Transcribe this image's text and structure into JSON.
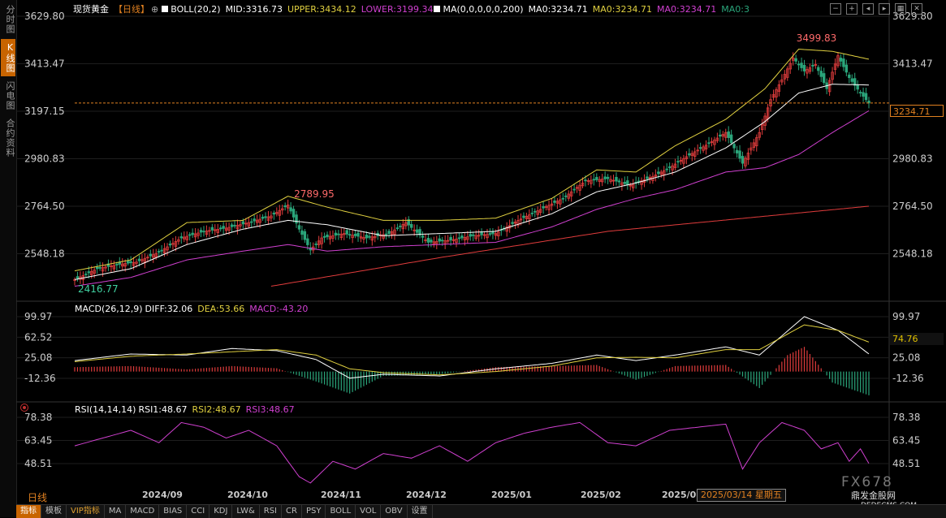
{
  "left_tabs": [
    "分时图",
    "K线图",
    "闪电图",
    "合约资料"
  ],
  "active_tab": 1,
  "header": {
    "symbol": "现货黄金",
    "period": "【日线】",
    "plus": "⊕",
    "boll": "BOLL(20,2)",
    "mid": "MID:3316.73",
    "upper": "UPPER:3434.12",
    "lower": "LOWER:3199.34",
    "ma": "MA(0,0,0,0,0,200)",
    "ma_a": "MA0:3234.71",
    "ma_b": "MA0:3234.71",
    "ma_c": "MA0:3234.71",
    "ma_d": "MA0:3"
  },
  "macd_header": {
    "name": "MACD(26,12,9)",
    "diff": "DIFF:32.06",
    "dea": "DEA:53.66",
    "macd": "MACD:-43.20"
  },
  "rsi_header": {
    "name": "RSI(14,14,14)",
    "rsi1": "RSI1:48.67",
    "rsi2": "RSI2:48.67",
    "rsi3": "RSI3:48.67"
  },
  "price_tag": "3234.71",
  "macd_tag": "74.76",
  "date_tag": "2025/03/14 星期五",
  "period_label": "日线",
  "toolbar": [
    "指标",
    "模板",
    "VIP指标",
    "MA",
    "MACD",
    "BIAS",
    "CCI",
    "KDJ",
    "LW&",
    "RSI",
    "CR",
    "PSY",
    "BOLL",
    "VOL",
    "OBV",
    "设置"
  ],
  "watermark": {
    "brand": "FX678",
    "site": "鼎发金股网",
    "domain": "DEDECMS.COM"
  },
  "colors": {
    "up": "#e03c3c",
    "down": "#2aa57a",
    "upper": "#e0d040",
    "lower": "#d040d0",
    "mid": "#ffffff",
    "ma200": "#e03c3c",
    "dea": "#e0d040",
    "diff": "#ffffff",
    "rsi": "#d040d0",
    "accent": "#e08020"
  },
  "chart_data": [
    {
      "type": "candlestick",
      "title": "现货黄金 日线",
      "ylim": [
        2416.77,
        3629.8
      ],
      "y_ticks": [
        3629.8,
        3413.47,
        3197.15,
        2980.83,
        2764.5,
        2548.18
      ],
      "x_labels": [
        "2024/09",
        "2024/10",
        "2024/11",
        "2024/12",
        "2025/01",
        "2025/02",
        "2025/0"
      ],
      "annotations": [
        {
          "label": "3499.83",
          "value": 3499.83
        },
        {
          "label": "2789.95",
          "value": 2789.95
        },
        {
          "label": "2416.77",
          "value": 2416.77
        }
      ],
      "last_price": 3234.71,
      "close_path": [
        [
          0,
          2430
        ],
        [
          8,
          2480
        ],
        [
          16,
          2500
        ],
        [
          22,
          2510
        ],
        [
          30,
          2555
        ],
        [
          38,
          2620
        ],
        [
          46,
          2650
        ],
        [
          54,
          2665
        ],
        [
          62,
          2690
        ],
        [
          70,
          2720
        ],
        [
          76,
          2770
        ],
        [
          80,
          2660
        ],
        [
          84,
          2565
        ],
        [
          88,
          2620
        ],
        [
          96,
          2640
        ],
        [
          104,
          2620
        ],
        [
          112,
          2640
        ],
        [
          118,
          2690
        ],
        [
          126,
          2600
        ],
        [
          134,
          2610
        ],
        [
          142,
          2630
        ],
        [
          150,
          2640
        ],
        [
          158,
          2700
        ],
        [
          166,
          2750
        ],
        [
          174,
          2800
        ],
        [
          182,
          2880
        ],
        [
          190,
          2890
        ],
        [
          198,
          2860
        ],
        [
          206,
          2900
        ],
        [
          212,
          2940
        ],
        [
          218,
          2990
        ],
        [
          226,
          3050
        ],
        [
          232,
          3100
        ],
        [
          238,
          2960
        ],
        [
          244,
          3100
        ],
        [
          248,
          3250
        ],
        [
          252,
          3340
        ],
        [
          256,
          3440
        ],
        [
          260,
          3380
        ],
        [
          264,
          3410
        ],
        [
          268,
          3300
        ],
        [
          272,
          3450
        ],
        [
          276,
          3350
        ],
        [
          280,
          3280
        ],
        [
          283,
          3234.71
        ]
      ],
      "boll_upper": [
        [
          0,
          2470
        ],
        [
          20,
          2520
        ],
        [
          40,
          2690
        ],
        [
          60,
          2700
        ],
        [
          76,
          2810
        ],
        [
          90,
          2760
        ],
        [
          110,
          2700
        ],
        [
          130,
          2700
        ],
        [
          150,
          2710
        ],
        [
          170,
          2800
        ],
        [
          186,
          2930
        ],
        [
          200,
          2920
        ],
        [
          214,
          3040
        ],
        [
          232,
          3160
        ],
        [
          246,
          3300
        ],
        [
          258,
          3480
        ],
        [
          270,
          3470
        ],
        [
          283,
          3434.12
        ]
      ],
      "boll_mid": [
        [
          0,
          2430
        ],
        [
          20,
          2480
        ],
        [
          40,
          2590
        ],
        [
          60,
          2660
        ],
        [
          76,
          2700
        ],
        [
          90,
          2680
        ],
        [
          110,
          2630
        ],
        [
          130,
          2640
        ],
        [
          150,
          2650
        ],
        [
          170,
          2730
        ],
        [
          186,
          2830
        ],
        [
          200,
          2870
        ],
        [
          214,
          2920
        ],
        [
          232,
          3030
        ],
        [
          246,
          3150
        ],
        [
          258,
          3280
        ],
        [
          270,
          3320
        ],
        [
          283,
          3316.73
        ]
      ],
      "boll_lower": [
        [
          0,
          2400
        ],
        [
          20,
          2440
        ],
        [
          40,
          2520
        ],
        [
          60,
          2560
        ],
        [
          76,
          2590
        ],
        [
          90,
          2560
        ],
        [
          110,
          2580
        ],
        [
          130,
          2590
        ],
        [
          150,
          2600
        ],
        [
          170,
          2670
        ],
        [
          186,
          2750
        ],
        [
          200,
          2800
        ],
        [
          214,
          2840
        ],
        [
          232,
          2920
        ],
        [
          246,
          2940
        ],
        [
          258,
          3000
        ],
        [
          270,
          3100
        ],
        [
          283,
          3199.34
        ]
      ],
      "ma200": [
        [
          70,
          2400
        ],
        [
          130,
          2530
        ],
        [
          190,
          2650
        ],
        [
          283,
          2764.5
        ]
      ]
    },
    {
      "type": "bar",
      "title": "MACD(26,12,9)",
      "ylim": [
        -30,
        105
      ],
      "y_ticks": [
        99.97,
        62.52,
        25.08,
        -12.36
      ],
      "diff_path": [
        [
          0,
          20
        ],
        [
          20,
          32
        ],
        [
          40,
          30
        ],
        [
          56,
          42
        ],
        [
          72,
          38
        ],
        [
          86,
          22
        ],
        [
          98,
          -12
        ],
        [
          110,
          -5
        ],
        [
          130,
          -8
        ],
        [
          150,
          5
        ],
        [
          170,
          15
        ],
        [
          186,
          30
        ],
        [
          200,
          20
        ],
        [
          214,
          30
        ],
        [
          232,
          45
        ],
        [
          244,
          30
        ],
        [
          260,
          100
        ],
        [
          272,
          75
        ],
        [
          283,
          32.06
        ]
      ],
      "dea_path": [
        [
          0,
          18
        ],
        [
          20,
          28
        ],
        [
          40,
          32
        ],
        [
          56,
          36
        ],
        [
          72,
          40
        ],
        [
          86,
          30
        ],
        [
          98,
          5
        ],
        [
          110,
          -2
        ],
        [
          130,
          -6
        ],
        [
          150,
          0
        ],
        [
          170,
          10
        ],
        [
          186,
          25
        ],
        [
          200,
          26
        ],
        [
          214,
          25
        ],
        [
          232,
          40
        ],
        [
          244,
          40
        ],
        [
          260,
          85
        ],
        [
          272,
          75
        ],
        [
          283,
          53.66
        ]
      ],
      "hist_path": [
        [
          0,
          8
        ],
        [
          20,
          10
        ],
        [
          40,
          4
        ],
        [
          56,
          10
        ],
        [
          72,
          6
        ],
        [
          86,
          -18
        ],
        [
          98,
          -40
        ],
        [
          110,
          -8
        ],
        [
          130,
          -5
        ],
        [
          150,
          8
        ],
        [
          170,
          10
        ],
        [
          186,
          12
        ],
        [
          200,
          -15
        ],
        [
          214,
          10
        ],
        [
          232,
          12
        ],
        [
          244,
          -30
        ],
        [
          254,
          30
        ],
        [
          260,
          45
        ],
        [
          270,
          -20
        ],
        [
          283,
          -43.2
        ]
      ]
    },
    {
      "type": "line",
      "title": "RSI(14,14,14)",
      "ylim": [
        35,
        82
      ],
      "y_ticks": [
        78.38,
        63.45,
        48.51
      ],
      "rsi_path": [
        [
          0,
          60
        ],
        [
          10,
          65
        ],
        [
          20,
          70
        ],
        [
          30,
          62
        ],
        [
          38,
          75
        ],
        [
          46,
          72
        ],
        [
          54,
          65
        ],
        [
          62,
          70
        ],
        [
          72,
          60
        ],
        [
          80,
          40
        ],
        [
          84,
          36
        ],
        [
          92,
          50
        ],
        [
          100,
          45
        ],
        [
          110,
          55
        ],
        [
          120,
          52
        ],
        [
          130,
          60
        ],
        [
          140,
          50
        ],
        [
          150,
          62
        ],
        [
          160,
          68
        ],
        [
          170,
          72
        ],
        [
          180,
          75
        ],
        [
          190,
          62
        ],
        [
          200,
          60
        ],
        [
          212,
          70
        ],
        [
          222,
          72
        ],
        [
          232,
          74
        ],
        [
          238,
          45
        ],
        [
          244,
          62
        ],
        [
          252,
          75
        ],
        [
          260,
          70
        ],
        [
          266,
          58
        ],
        [
          272,
          62
        ],
        [
          276,
          50
        ],
        [
          280,
          58
        ],
        [
          283,
          48.67
        ]
      ]
    }
  ]
}
